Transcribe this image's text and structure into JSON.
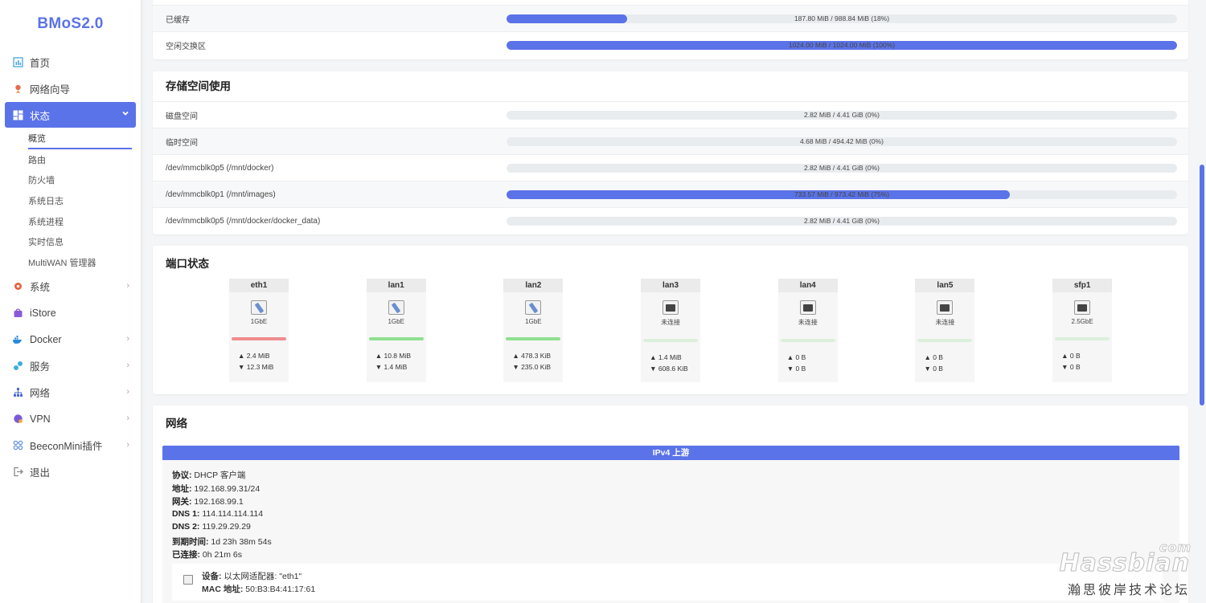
{
  "logo": "BMoS2.0",
  "sidebar": {
    "items": [
      {
        "label": "首页"
      },
      {
        "label": "网络向导"
      },
      {
        "label": "状态"
      },
      {
        "label": "系统"
      },
      {
        "label": "iStore"
      },
      {
        "label": "Docker"
      },
      {
        "label": "服务"
      },
      {
        "label": "网络"
      },
      {
        "label": "VPN"
      },
      {
        "label": "BeeconMini插件"
      },
      {
        "label": "退出"
      }
    ],
    "status_sub": [
      {
        "label": "概览"
      },
      {
        "label": "路由"
      },
      {
        "label": "防火墙"
      },
      {
        "label": "系统日志"
      },
      {
        "label": "系统进程"
      },
      {
        "label": "实时信息"
      },
      {
        "label": "MultiWAN 管理器"
      }
    ]
  },
  "memory": {
    "rows": [
      {
        "label": "已缓存",
        "text": "187.80 MiB / 988.84 MiB (18%)",
        "percent": 18
      },
      {
        "label": "空闲交换区",
        "text": "1024.00 MiB / 1024.00 MiB (100%)",
        "percent": 100
      }
    ]
  },
  "storage": {
    "title": "存储空间使用",
    "rows": [
      {
        "label": "磁盘空间",
        "text": "2.82 MiB / 4.41 GiB (0%)",
        "percent": 0
      },
      {
        "label": "临时空间",
        "text": "4.68 MiB / 494.42 MiB (0%)",
        "percent": 0
      },
      {
        "label": "/dev/mmcblk0p5 (/mnt/docker)",
        "text": "2.82 MiB / 4.41 GiB (0%)",
        "percent": 0
      },
      {
        "label": "/dev/mmcblk0p1 (/mnt/images)",
        "text": "733.57 MiB / 973.42 MiB (75%)",
        "percent": 75
      },
      {
        "label": "/dev/mmcblk0p5 (/mnt/docker/docker_data)",
        "text": "2.82 MiB / 4.41 GiB (0%)",
        "percent": 0
      }
    ]
  },
  "ports": {
    "title": "端口状态",
    "items": [
      {
        "name": "eth1",
        "speed": "1GbE",
        "tx": "▲ 2.4 MiB",
        "rx": "▼ 12.3 MiB",
        "connected": true,
        "line_color": "#f08d8d"
      },
      {
        "name": "lan1",
        "speed": "1GbE",
        "tx": "▲ 10.8 MiB",
        "rx": "▼ 1.4 MiB",
        "connected": true,
        "line_color": "#8fe08f"
      },
      {
        "name": "lan2",
        "speed": "1GbE",
        "tx": "▲ 478.3 KiB",
        "rx": "▼ 235.0 KiB",
        "connected": true,
        "line_color": "#8fe08f"
      },
      {
        "name": "lan3",
        "speed": "未连接",
        "tx": "▲ 1.4 MiB",
        "rx": "▼ 608.6 KiB",
        "connected": false,
        "line_color": "#dcefdc"
      },
      {
        "name": "lan4",
        "speed": "未连接",
        "tx": "▲ 0 B",
        "rx": "▼ 0 B",
        "connected": false,
        "line_color": "#dcefdc"
      },
      {
        "name": "lan5",
        "speed": "未连接",
        "tx": "▲ 0 B",
        "rx": "▼ 0 B",
        "connected": false,
        "line_color": "#dcefdc"
      },
      {
        "name": "sfp1",
        "speed": "2.5GbE",
        "tx": "▲ 0 B",
        "rx": "▼ 0 B",
        "connected": false,
        "line_color": "#dcefdc"
      }
    ]
  },
  "network": {
    "title": "网络",
    "ipv4_title": "IPv4 上游",
    "fields": [
      {
        "k": "协议:",
        "v": " DHCP 客户端"
      },
      {
        "k": "地址:",
        "v": " 192.168.99.31/24"
      },
      {
        "k": "网关:",
        "v": " 192.168.99.1"
      },
      {
        "k": "DNS 1:",
        "v": " 114.114.114.114"
      },
      {
        "k": "DNS 2:",
        "v": " 119.29.29.29"
      },
      {
        "k": "到期时间:",
        "v": " 1d 23h 38m 54s"
      },
      {
        "k": "已连接:",
        "v": " 0h 21m 6s"
      }
    ],
    "device": {
      "k1": "设备:",
      "v1": " 以太网适配器: \"eth1\"",
      "k2": "MAC 地址:",
      "v2": " 50:B3:B4:41:17:61"
    }
  },
  "watermark": {
    "brand": "Hassbian",
    "com": "com",
    "subtitle": "瀚思彼岸技术论坛"
  },
  "colors": {
    "accent": "#5b73e8"
  }
}
